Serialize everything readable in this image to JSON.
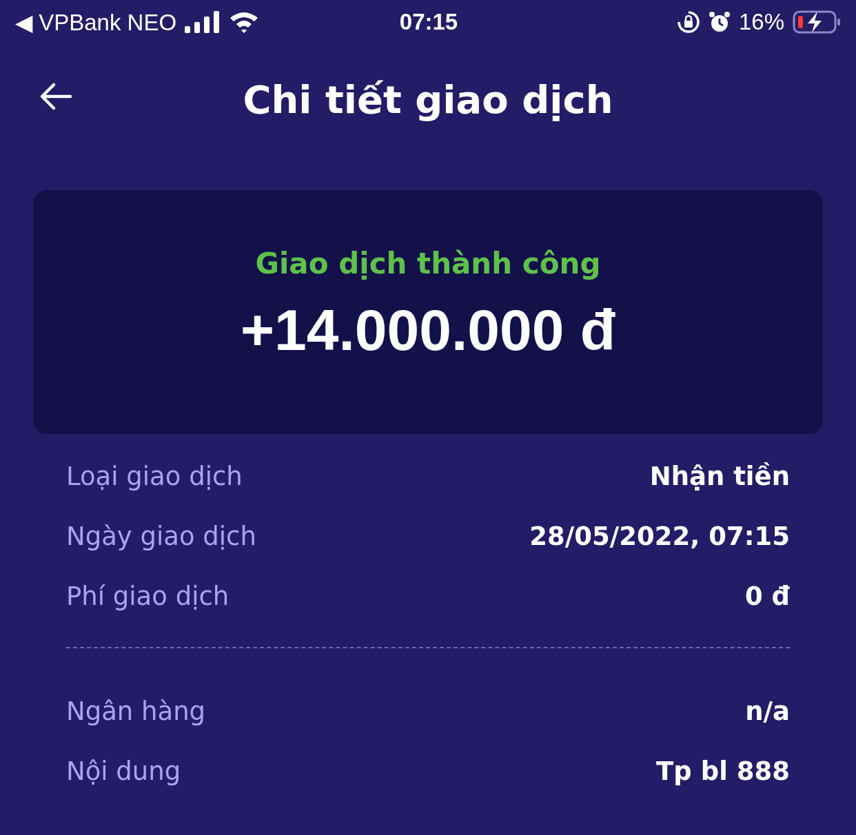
{
  "status_bar": {
    "back_app": "◀ VPBank NEO",
    "time": "07:15",
    "battery": "16%"
  },
  "header": {
    "title": "Chi tiết giao dịch"
  },
  "summary": {
    "status": "Giao dịch thành công",
    "amount": "+14.000.000 đ"
  },
  "details": [
    {
      "label": "Loại giao dịch",
      "value": "Nhận tiền"
    },
    {
      "label": "Ngày giao dịch",
      "value": "28/05/2022, 07:15"
    },
    {
      "label": "Phí giao dịch",
      "value": "0 đ"
    }
  ],
  "details_2": [
    {
      "label": "Ngân hàng",
      "value": "n/a"
    },
    {
      "label": "Nội dung",
      "value": "Tp bl 888"
    }
  ]
}
